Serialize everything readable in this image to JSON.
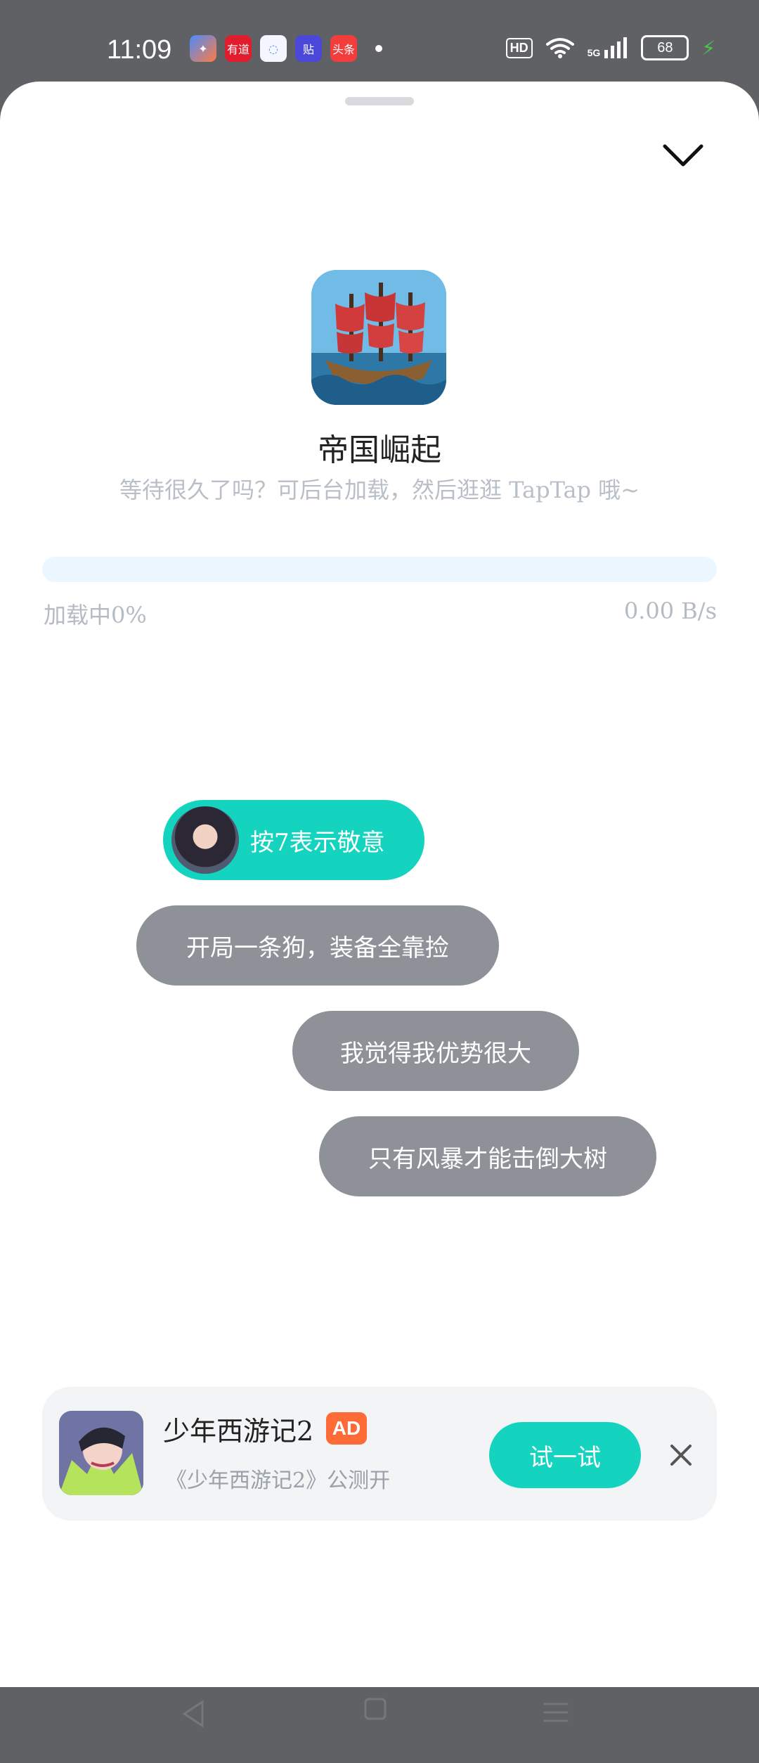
{
  "status_bar": {
    "time": "11:09",
    "notification_apps": [
      "有道",
      "贴",
      "头条"
    ],
    "hd_label": "HD",
    "network": "5G",
    "battery": "68"
  },
  "game": {
    "title": "帝国崛起",
    "subtitle": "等待很久了吗？可后台加载，然后逛逛 TapTap 哦~",
    "progress_percent": 0,
    "loading_text": "加载中0%",
    "speed_text": "0.00 B/s"
  },
  "bubbles": [
    {
      "text": "按7表示敬意"
    },
    {
      "text": "开局一条狗，装备全靠捡"
    },
    {
      "text": "我觉得我优势很大"
    },
    {
      "text": "只有风暴才能击倒大树"
    }
  ],
  "ad": {
    "title": "少年西游记2",
    "badge": "AD",
    "subtitle": "《少年西游记2》公测开",
    "button": "试一试"
  },
  "colors": {
    "accent": "#14d4bf",
    "bubble_gray": "#8e9298",
    "ad_badge": "#ff6b36"
  },
  "icons": [
    "collapse-chevron-icon",
    "close-icon",
    "back-triangle-icon",
    "home-square-icon",
    "menu-lines-icon"
  ]
}
